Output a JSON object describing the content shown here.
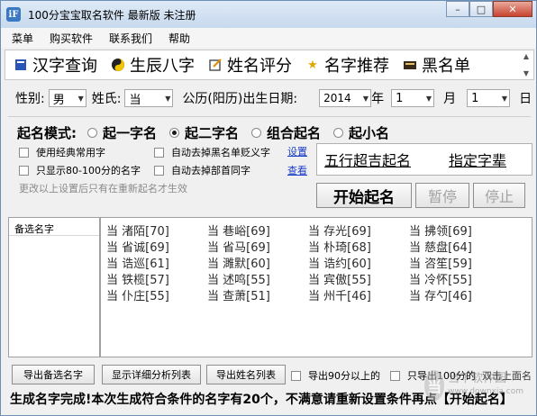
{
  "window": {
    "title": "100分宝宝取名软件 最新版  未注册",
    "minimize": "–",
    "maximize": "□",
    "close": "✕"
  },
  "menu": [
    "菜单",
    "购买软件",
    "联系我们",
    "帮助"
  ],
  "toolbar": [
    {
      "label": "汉字查询",
      "icon": "book-icon"
    },
    {
      "label": "生辰八字",
      "icon": "yinyang-icon"
    },
    {
      "label": "姓名评分",
      "icon": "edit-icon"
    },
    {
      "label": "名字推荐",
      "icon": "star-icon"
    },
    {
      "label": "黑名单",
      "icon": "blacklist-icon"
    }
  ],
  "form": {
    "gender_label": "性别:",
    "gender_value": "男",
    "surname_label": "姓氏:",
    "surname_value": "当",
    "date_label": "公历(阳历)出生日期:",
    "year_value": "2014",
    "year_unit": "年",
    "month_value": "1",
    "month_unit": "月",
    "day_value": "1",
    "day_unit": "日"
  },
  "mode": {
    "label": "起名模式:",
    "options": [
      {
        "label": "起一字名",
        "selected": false
      },
      {
        "label": "起二字名",
        "selected": true
      },
      {
        "label": "组合起名",
        "selected": false
      },
      {
        "label": "起小名",
        "selected": false
      }
    ]
  },
  "options": {
    "classic": "使用经典常用字",
    "only80": "只显示80-100分的名字",
    "remove_blacklist": "自动去掉黑名单贬义字",
    "remove_radical": "自动去掉部首同字",
    "settings_link": "设置",
    "view_link": "查看",
    "hint": "更改以上设置后只有在重新起名才生效"
  },
  "wuxing": {
    "left": "五行超吉起名",
    "right": "指定字辈"
  },
  "buttons": {
    "start": "开始起名",
    "pause": "暂停",
    "stop": "停止"
  },
  "candidates_header": "备选名字",
  "names": [
    "当  渚陌[70]",
    "当  巷峪[69]",
    "当  存光[69]",
    "当  拂领[69]",
    "当  省诚[69]",
    "当  省马[69]",
    "当  朴琦[68]",
    "当  慈盘[64]",
    "当  诰巡[61]",
    "当  濉默[60]",
    "当  诰约[60]",
    "当  咨笙[59]",
    "当  铁榄[57]",
    "当  述鸣[55]",
    "当  宾傲[55]",
    "当  冷怀[55]",
    "当  仆庄[55]",
    "当  查萧[51]",
    "当  州千[46]",
    "当  存勺[46]"
  ],
  "bottom": {
    "export_candidates": "导出备选名字",
    "show_detail": "显示详细分析列表",
    "export_list": "导出姓名列表",
    "export90": "导出90分以上的",
    "export100": "只导出100分的",
    "dblclick": "双击上面名"
  },
  "status": "生成名字完成!本次生成符合条件的名字有20个，不满意请重新设置条件再点【开始起名】",
  "watermark": {
    "logo": "当",
    "line1": "当下软件园",
    "line2": "www.downxia.com"
  }
}
